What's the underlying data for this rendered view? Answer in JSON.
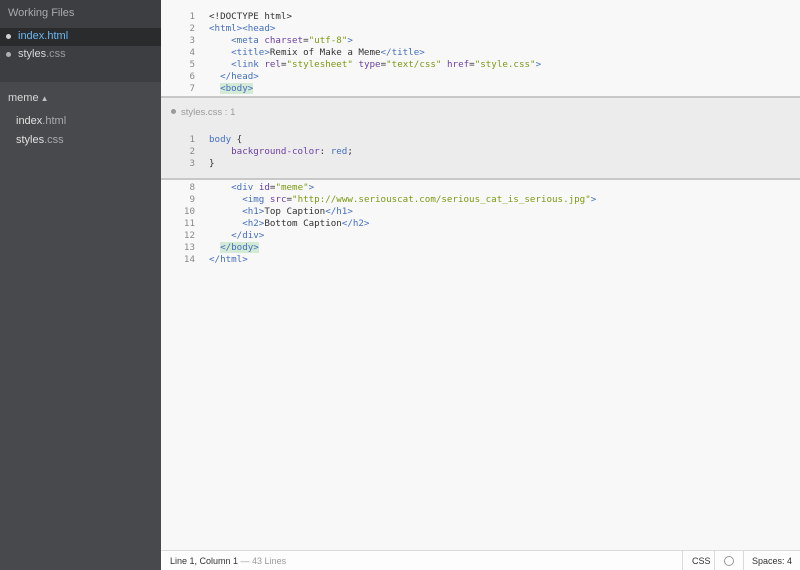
{
  "sidebar": {
    "working_files_title": "Working Files",
    "working_files": [
      {
        "name": "index",
        "ext": ".html",
        "active": true
      },
      {
        "name": "styles",
        "ext": ".css",
        "active": false
      }
    ],
    "project_title": "meme",
    "project_toggle_icon": "updown-icon",
    "tree": [
      {
        "name": "index",
        "ext": ".html"
      },
      {
        "name": "styles",
        "ext": ".css"
      }
    ]
  },
  "editor": {
    "lines_top": [
      {
        "n": "1",
        "code": "<!DOCTYPE html>"
      },
      {
        "n": "2",
        "code": "<html><head>"
      },
      {
        "n": "3",
        "code": "    <meta charset=\"utf-8\">"
      },
      {
        "n": "4",
        "code": "    <title>Remix of Make a Meme</title>"
      },
      {
        "n": "5",
        "code": "    <link rel=\"stylesheet\" type=\"text/css\" href=\"style.css\">"
      },
      {
        "n": "6",
        "code": "  </head>"
      },
      {
        "n": "7",
        "code": "  <body>"
      }
    ],
    "inline_editor": {
      "header": "styles.css : 1",
      "lines": [
        {
          "n": "1",
          "code": "body {"
        },
        {
          "n": "2",
          "code": "    background-color: red;"
        },
        {
          "n": "3",
          "code": "}"
        }
      ]
    },
    "lines_bottom": [
      {
        "n": "8",
        "code": "    <div id=\"meme\">"
      },
      {
        "n": "9",
        "code": "      <img src=\"http://www.seriouscat.com/serious_cat_is_serious.jpg\">"
      },
      {
        "n": "10",
        "code": "      <h1>Top Caption</h1>"
      },
      {
        "n": "11",
        "code": "      <h2>Bottom Caption</h2>"
      },
      {
        "n": "12",
        "code": "    </div>"
      },
      {
        "n": "13",
        "code": "  </body>"
      },
      {
        "n": "14",
        "code": "</html>"
      }
    ]
  },
  "statusbar": {
    "position": "Line 1, Column 1",
    "lines": " — 43 Lines",
    "language": "CSS",
    "lint_icon": "circle-icon",
    "spaces": "Spaces:  4"
  }
}
